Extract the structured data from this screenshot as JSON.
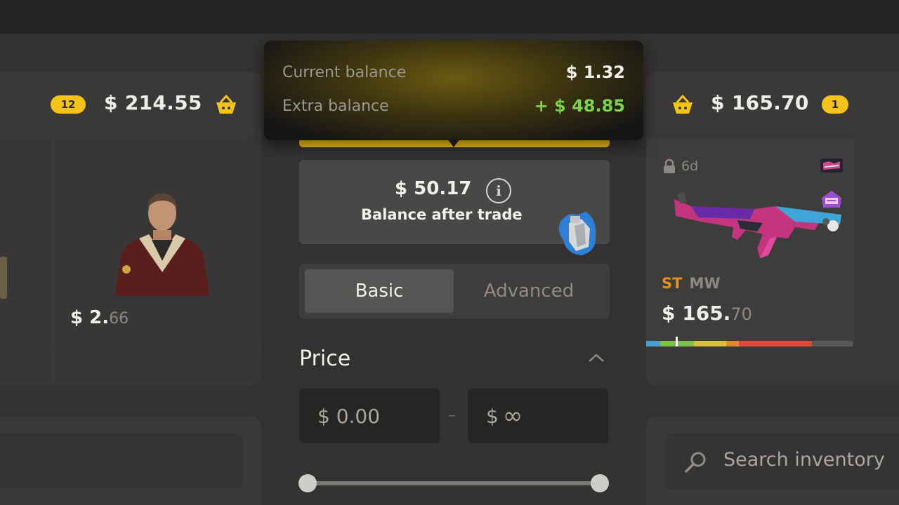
{
  "left_panel": {
    "item_count": "12",
    "total": "$ 214.55",
    "items": [
      {
        "price_main": "$ 2.",
        "price_cents": "66"
      }
    ]
  },
  "balance_popover": {
    "current_label": "Current balance",
    "current_value": "$ 1.32",
    "extra_label": "Extra balance",
    "extra_value": "+ $ 48.85"
  },
  "balance_after": {
    "amount": "$ 50.17",
    "caption": "Balance after trade"
  },
  "filter_tabs": {
    "basic": "Basic",
    "advanced": "Advanced",
    "active": "Basic"
  },
  "price_filter": {
    "title": "Price",
    "min_value": "$ 0.00",
    "max_prefix": "$",
    "max_value": "∞",
    "separator": "–"
  },
  "right_panel": {
    "total": "$ 165.70",
    "item_count": "1",
    "item": {
      "lock_text": "6d",
      "quality": "ST",
      "wear": "MW",
      "price_main": "$ 165.",
      "price_cents": "70"
    }
  },
  "search": {
    "placeholder": "Search inventory"
  },
  "colors": {
    "accent": "#f3c319",
    "positive": "#7cd14b",
    "stattrak": "#e3901f"
  }
}
